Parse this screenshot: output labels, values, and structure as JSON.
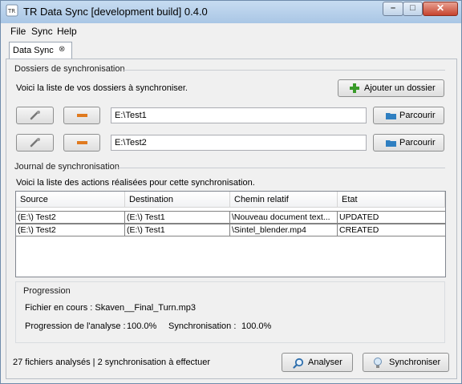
{
  "window": {
    "title": "TR Data Sync [development build] 0.4.0"
  },
  "menu": [
    "File",
    "Sync",
    "Help"
  ],
  "tab": {
    "label": "Data Sync"
  },
  "folders": {
    "group_title": "Dossiers de synchronisation",
    "description": "Voici la liste de vos dossiers à synchroniser.",
    "add_button": "Ajouter un dossier",
    "browse_label": "Parcourir",
    "paths": [
      "E:\\Test1",
      "E:\\Test2"
    ]
  },
  "journal": {
    "group_title": "Journal de synchronisation",
    "description": "Voici la liste des actions réalisées pour cette synchronisation.",
    "columns": [
      "Source",
      "Destination",
      "Chemin relatif",
      "Etat"
    ],
    "rows": [
      [
        "(E:\\) Test2",
        "(E:\\) Test1",
        "\\Nouveau document text...",
        "UPDATED"
      ],
      [
        "(E:\\) Test2",
        "(E:\\) Test1",
        "\\Sintel_blender.mp4",
        "CREATED"
      ]
    ]
  },
  "progress": {
    "group_title": "Progression",
    "current_file": "Fichier en cours :  Skaven__Final_Turn.mp3",
    "analysis_label": "Progression de l'analyse :",
    "analysis_value": "100.0%",
    "sync_label": "Synchronisation :",
    "sync_value": "100.0%"
  },
  "status": {
    "summary": "27 fichiers analysés | 2 synchronisation à effectuer",
    "analyze_button": "Analyser",
    "sync_button": "Synchroniser"
  },
  "colors": {
    "add_icon": "#3a9b2a",
    "remove_icon": "#e07a1f",
    "folder_icon": "#2f7fc1"
  }
}
